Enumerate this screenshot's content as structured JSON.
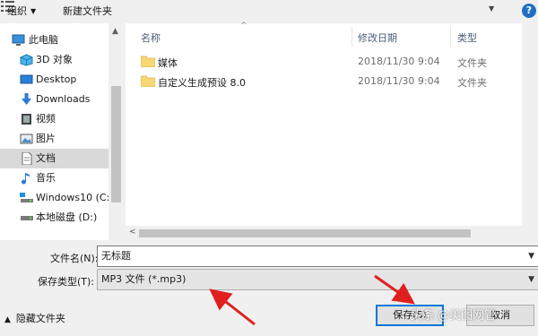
{
  "toolbar": {
    "organize": "组织",
    "new_folder": "新建文件夹",
    "view_icon": "view-options-icon",
    "help": "?"
  },
  "nav": {
    "items": [
      {
        "label": "此电脑",
        "icon": "this-pc-icon"
      },
      {
        "label": "3D 对象",
        "icon": "3d-objects-icon"
      },
      {
        "label": "Desktop",
        "icon": "desktop-icon"
      },
      {
        "label": "Downloads",
        "icon": "downloads-icon"
      },
      {
        "label": "视频",
        "icon": "videos-icon"
      },
      {
        "label": "图片",
        "icon": "pictures-icon"
      },
      {
        "label": "文档",
        "icon": "documents-icon",
        "selected": true
      },
      {
        "label": "音乐",
        "icon": "music-icon"
      },
      {
        "label": "Windows10 (C:",
        "icon": "drive-c-icon"
      },
      {
        "label": "本地磁盘 (D:)",
        "icon": "drive-d-icon"
      }
    ]
  },
  "list": {
    "columns": {
      "name": "名称",
      "date": "修改日期",
      "type": "类型"
    },
    "rows": [
      {
        "name": "媒体",
        "date": "2018/11/30 9:04",
        "type": "文件夹"
      },
      {
        "name": "自定义生成预设 8.0",
        "date": "2018/11/30 9:04",
        "type": "文件夹"
      }
    ]
  },
  "form": {
    "filename_label": "文件名(N):",
    "filename_value": "无标题",
    "filetype_label": "保存类型(T):",
    "filetype_value": "MP3 文件 (*.mp3)"
  },
  "footer": {
    "hide_folders": "隐藏文件夹",
    "save": "保存(S)",
    "cancel": "取消"
  },
  "colors": {
    "accent": "#0078d7",
    "folder": "#f8d775",
    "arrow": "#e02020",
    "selected": "#d9d9d9"
  },
  "watermark": "头条 @美图网管"
}
